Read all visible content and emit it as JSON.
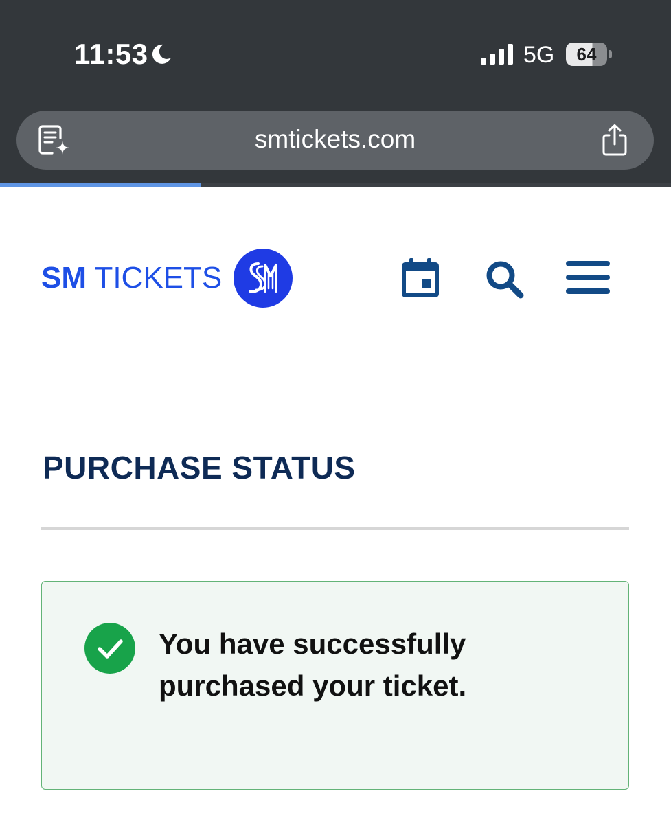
{
  "status_bar": {
    "time": "11:53",
    "network": "5G",
    "battery_level": "64",
    "battery_fraction": 0.64,
    "icons": [
      "moon-icon",
      "signal-icon"
    ]
  },
  "browser": {
    "url": "smtickets.com",
    "load_progress": 0.3,
    "icons": [
      "reader-icon",
      "share-icon"
    ]
  },
  "site_header": {
    "logo_part1": "SM",
    "logo_part2": "TICKETS",
    "brand_color": "#1e4fe6",
    "icons": [
      "calendar-icon",
      "search-icon",
      "menu-icon"
    ],
    "icon_color": "#124a86"
  },
  "main": {
    "title": "PURCHASE STATUS",
    "alert": {
      "message": "You have successfully purchased your ticket.",
      "status_color": "#18a34a",
      "icon": "check-circle-icon"
    }
  }
}
